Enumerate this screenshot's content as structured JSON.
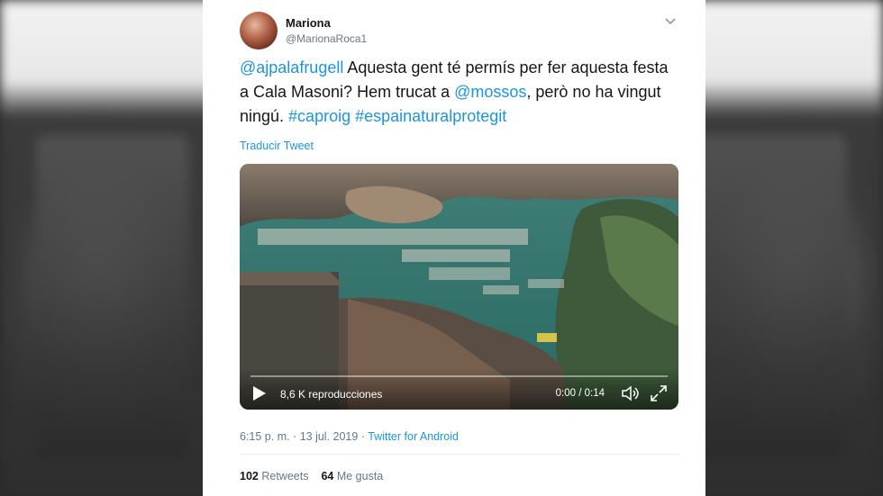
{
  "tweet": {
    "author_name": "Mariona",
    "author_handle": "@MarionaRoca1",
    "text": [
      {
        "type": "mention",
        "value": "@ajpalafrugell"
      },
      {
        "type": "text",
        "value": " Aquesta gent té permís per fer aquesta festa a Cala Masoni? Hem trucat a "
      },
      {
        "type": "mention",
        "value": "@mossos"
      },
      {
        "type": "text",
        "value": ", però no ha vingut ningú. "
      },
      {
        "type": "hashtag",
        "value": "#caproig"
      },
      {
        "type": "text",
        "value": " "
      },
      {
        "type": "hashtag",
        "value": "#espainaturalprotegit"
      }
    ],
    "translate_label": "Traducir Tweet",
    "video": {
      "views_label": "8,6 K reproducciones",
      "time_label": "0:00 / 0:14",
      "progress": 0
    },
    "timestamp": "6:15 p. m. · 13 jul. 2019",
    "separator": " · ",
    "client": "Twitter for Android",
    "retweets_count": "102",
    "retweets_label": "Retweets",
    "likes_count": "64",
    "likes_label": "Me gusta"
  },
  "icons": {
    "menu": "chevron-down-icon",
    "play": "play-icon",
    "volume": "volume-icon",
    "fullscreen": "fullscreen-icon"
  },
  "colors": {
    "link": "#1b95e0",
    "text": "#14171a",
    "secondary": "#657786"
  }
}
